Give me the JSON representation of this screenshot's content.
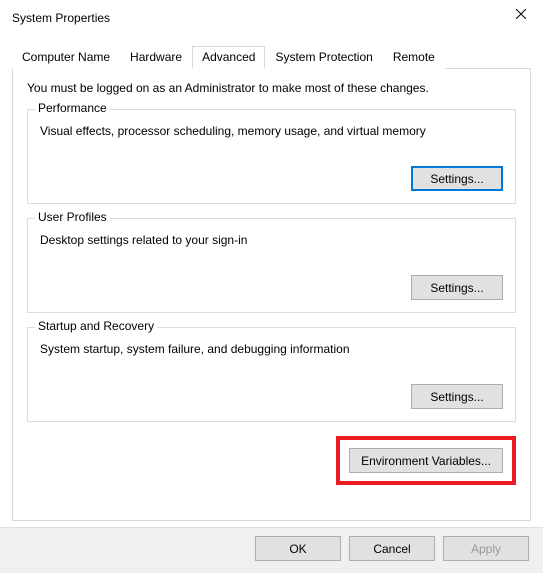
{
  "window": {
    "title": "System Properties"
  },
  "tabs": {
    "computer_name": "Computer Name",
    "hardware": "Hardware",
    "advanced": "Advanced",
    "system_protection": "System Protection",
    "remote": "Remote"
  },
  "advanced_tab": {
    "intro": "You must be logged on as an Administrator to make most of these changes.",
    "performance": {
      "legend": "Performance",
      "desc": "Visual effects, processor scheduling, memory usage, and virtual memory",
      "button": "Settings..."
    },
    "user_profiles": {
      "legend": "User Profiles",
      "desc": "Desktop settings related to your sign-in",
      "button": "Settings..."
    },
    "startup_recovery": {
      "legend": "Startup and Recovery",
      "desc": "System startup, system failure, and debugging information",
      "button": "Settings..."
    },
    "env_vars_button": "Environment Variables..."
  },
  "dialog_buttons": {
    "ok": "OK",
    "cancel": "Cancel",
    "apply": "Apply"
  }
}
